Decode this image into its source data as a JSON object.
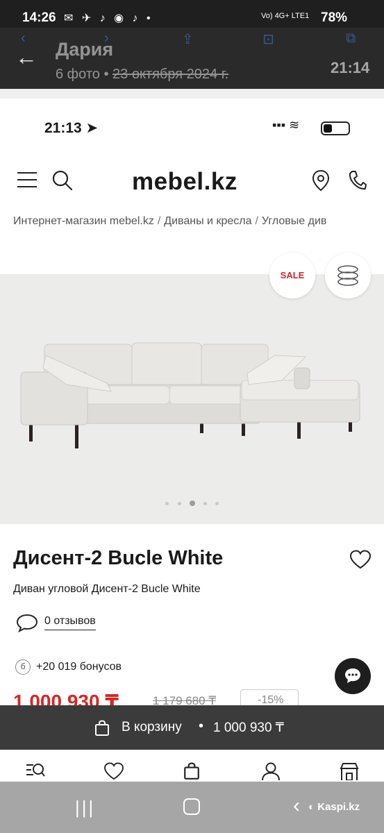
{
  "android_status": {
    "time": "14:26",
    "network": "Vo) 4G+ LTE1",
    "battery": "78%"
  },
  "gallery": {
    "name": "Дария",
    "photos": "6 фото",
    "date": "23 октября 2024 г.",
    "time": "21:14"
  },
  "ios_status": {
    "time": "21:13"
  },
  "site": {
    "logo": "mebel.kz"
  },
  "breadcrumb": [
    "Интернет-магазин mebel.kz",
    "Диваны и кресла",
    "Угловые див"
  ],
  "product": {
    "sale_badge": "SALE",
    "title": "Дисент-2 Bucle White",
    "subtitle": "Диван угловой Дисент-2 Bucle White",
    "reviews": "0 отзывов",
    "bonus_icon": "б",
    "bonus": "+20 019 бонусов",
    "price": "1 000 930 ₸",
    "old_price": "1 179 680 ₸",
    "discount": "-15%",
    "gallery_dots": {
      "count": 5,
      "active": 3
    }
  },
  "cart_bar": {
    "label": "В корзину",
    "separator": "•",
    "price": "1 000 930 ₸"
  },
  "bottom_nav": [
    "catalog-search-icon",
    "heart-icon",
    "bag-icon",
    "user-icon",
    "store-icon"
  ],
  "android_nav": {
    "overlay_label": "Kaspi.kz"
  },
  "colors": {
    "accent_red": "#d92525",
    "cart_bar": "#3b3b3b",
    "image_bg": "#ececeb"
  }
}
